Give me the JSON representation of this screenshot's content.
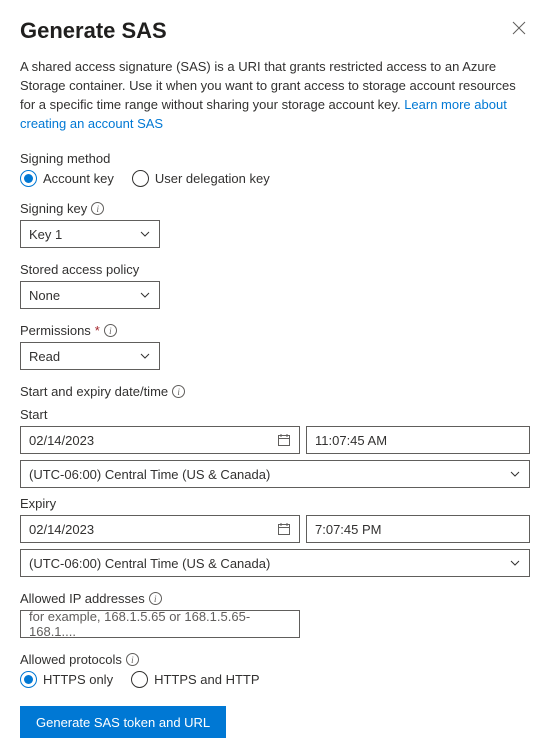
{
  "header": {
    "title": "Generate SAS"
  },
  "description": {
    "text": "A shared access signature (SAS) is a URI that grants restricted access to an Azure Storage container. Use it when you want to grant access to storage account resources for a specific time range without sharing your storage account key. ",
    "link": "Learn more about creating an account SAS"
  },
  "signingMethod": {
    "label": "Signing method",
    "options": {
      "account": "Account key",
      "delegation": "User delegation key"
    }
  },
  "signingKey": {
    "label": "Signing key",
    "value": "Key 1"
  },
  "storedPolicy": {
    "label": "Stored access policy",
    "value": "None"
  },
  "permissions": {
    "label": "Permissions",
    "value": "Read"
  },
  "dateSection": {
    "label": "Start and expiry date/time",
    "start": {
      "label": "Start",
      "date": "02/14/2023",
      "time": "11:07:45 AM",
      "tz": "(UTC-06:00) Central Time (US & Canada)"
    },
    "expiry": {
      "label": "Expiry",
      "date": "02/14/2023",
      "time": "7:07:45 PM",
      "tz": "(UTC-06:00) Central Time (US & Canada)"
    }
  },
  "allowedIP": {
    "label": "Allowed IP addresses",
    "placeholder": "for example, 168.1.5.65 or 168.1.5.65-168.1...."
  },
  "allowedProtocols": {
    "label": "Allowed protocols",
    "options": {
      "httpsOnly": "HTTPS only",
      "both": "HTTPS and HTTP"
    }
  },
  "button": {
    "generate": "Generate SAS token and URL"
  }
}
